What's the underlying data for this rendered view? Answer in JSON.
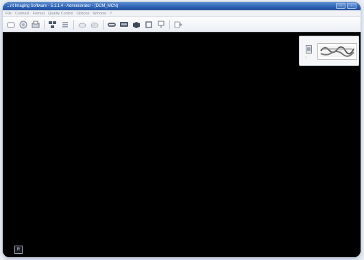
{
  "window": {
    "title": "...nt Imaging Software - 5.1.1.4 - Administrator - (DCM_MCN)",
    "minimize_glyph": "–",
    "maximize_glyph": "▫",
    "close_glyph": "✕"
  },
  "menu": {
    "items": [
      "File",
      "Contrast",
      "Format",
      "Quality Control",
      "Options",
      "Window",
      "?"
    ]
  },
  "toolbar": {
    "icons": [
      "new-icon",
      "open-icon",
      "print-icon",
      "layout-icon",
      "stack-icon",
      "cloud-icon",
      "network-icon",
      "scan-icon",
      "monitor-icon",
      "camera-icon",
      "frame-icon",
      "presentation-icon",
      "exit-icon"
    ]
  },
  "thumbnail": {
    "caption": "1"
  },
  "statusbar": {
    "corner_label": "R"
  },
  "colors": {
    "workspace_bg": "#000000",
    "titlebar_blue": "#2c62b5"
  }
}
